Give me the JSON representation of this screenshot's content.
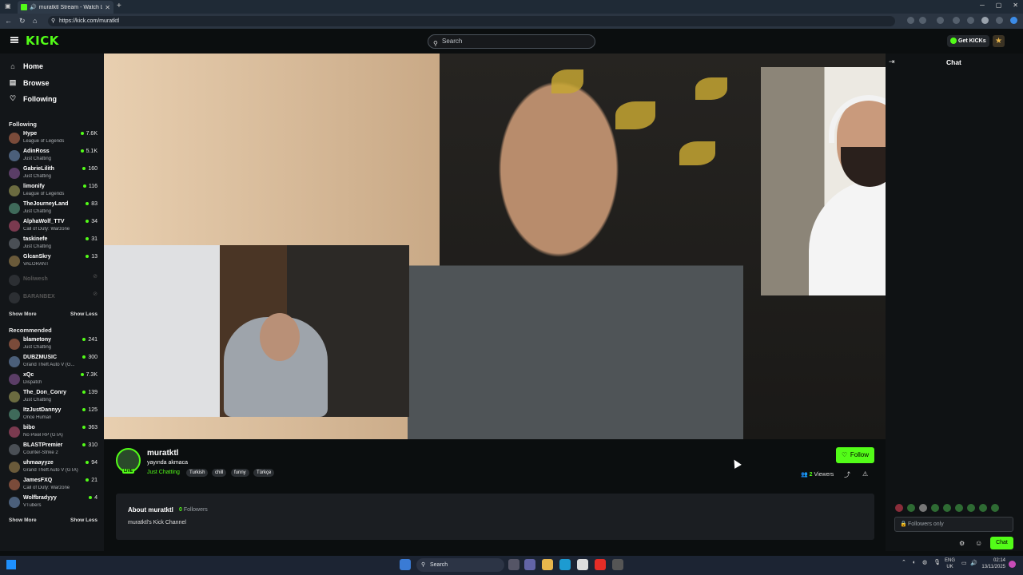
{
  "browser": {
    "tab_title": "muratktl Stream - Watch Liv",
    "url": "https://kick.com/muratktl"
  },
  "header": {
    "logo": "KICK",
    "search_placeholder": "Search",
    "get_kicks": "Get KICKs"
  },
  "sidebar": {
    "nav": [
      {
        "label": "Home",
        "icon": "home-icon"
      },
      {
        "label": "Browse",
        "icon": "browse-icon"
      },
      {
        "label": "Following",
        "icon": "heart-icon"
      }
    ],
    "following_title": "Following",
    "following": [
      {
        "name": "Hype",
        "category": "League of Legends",
        "viewers": "7.6K"
      },
      {
        "name": "AdinRoss",
        "category": "Just Chatting",
        "viewers": "5.1K"
      },
      {
        "name": "GabrieLilith",
        "category": "Just Chatting",
        "viewers": "160"
      },
      {
        "name": "limonify",
        "category": "League of Legends",
        "viewers": "116"
      },
      {
        "name": "TheJourneyLand",
        "category": "Just Chatting",
        "viewers": "83"
      },
      {
        "name": "AlphaWolf_TTV",
        "category": "Call of Duty: Warzone",
        "viewers": "34"
      },
      {
        "name": "taskinefe",
        "category": "Just Chatting",
        "viewers": "31"
      },
      {
        "name": "GlcanSkry",
        "category": "VALORANT",
        "viewers": "13"
      }
    ],
    "offline": [
      {
        "name": "Noliwesh",
        "viewers": "⊘"
      },
      {
        "name": "BARANBEX",
        "viewers": "⊘"
      }
    ],
    "show_more": "Show More",
    "show_less": "Show Less",
    "recommended_title": "Recommended",
    "recommended": [
      {
        "name": "blametony",
        "category": "Just Chatting",
        "viewers": "241"
      },
      {
        "name": "DUBZMUSIC",
        "category": "Grand Theft Auto V (G...",
        "viewers": "300"
      },
      {
        "name": "xQc",
        "category": "Dispatch",
        "viewers": "7.3K"
      },
      {
        "name": "The_Don_Conry",
        "category": "Just Chatting",
        "viewers": "139"
      },
      {
        "name": "ItzJustDannyy",
        "category": "Once Human",
        "viewers": "125"
      },
      {
        "name": "bibo",
        "category": "No Pixel RP (GTA)",
        "viewers": "363"
      },
      {
        "name": "BLASTPremier",
        "category": "Counter-Strike 2",
        "viewers": "310"
      },
      {
        "name": "uhmaayyze",
        "category": "Grand Theft Auto V (GTA)",
        "viewers": "94"
      },
      {
        "name": "JamesFXQ",
        "category": "Call of Duty: Warzone",
        "viewers": "21"
      },
      {
        "name": "Wolfbradyyy",
        "category": "VTubers",
        "viewers": "4"
      }
    ]
  },
  "channel": {
    "name": "muratktl",
    "live_badge": "LIVE",
    "title": "yayında akmaca",
    "category": "Just Chatting",
    "tags": [
      "Turkish",
      "chill",
      "funny",
      "Türkçe"
    ],
    "follow_label": "Follow",
    "viewers_count": "2",
    "viewers_label": "Viewers",
    "about_title": "About muratktl",
    "followers_count": "0",
    "followers_label": "Followers",
    "description": "muratktl's Kick Channel"
  },
  "chat": {
    "title": "Chat",
    "input_placeholder": "Followers only",
    "send_label": "Chat"
  },
  "taskbar": {
    "search_placeholder": "Search",
    "lang_top": "ENG",
    "lang_bottom": "UK",
    "time": "02:14",
    "date": "13/11/2025"
  },
  "colors": {
    "accent": "#53fc18",
    "background": "#0b0e0f",
    "sidebar": "#131619"
  }
}
